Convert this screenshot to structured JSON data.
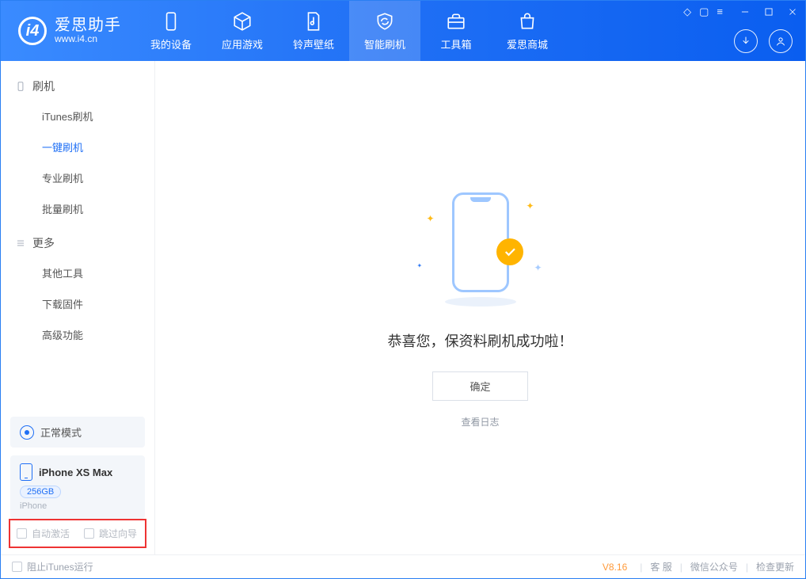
{
  "brand": {
    "title": "爱思助手",
    "sub": "www.i4.cn"
  },
  "tabs": [
    {
      "label": "我的设备"
    },
    {
      "label": "应用游戏"
    },
    {
      "label": "铃声壁纸"
    },
    {
      "label": "智能刷机"
    },
    {
      "label": "工具箱"
    },
    {
      "label": "爱思商城"
    }
  ],
  "sidebar": {
    "group1": {
      "title": "刷机"
    },
    "items1": [
      {
        "label": "iTunes刷机"
      },
      {
        "label": "一键刷机"
      },
      {
        "label": "专业刷机"
      },
      {
        "label": "批量刷机"
      }
    ],
    "group2": {
      "title": "更多"
    },
    "items2": [
      {
        "label": "其他工具"
      },
      {
        "label": "下载固件"
      },
      {
        "label": "高级功能"
      }
    ]
  },
  "mode": {
    "label": "正常模式"
  },
  "device": {
    "name": "iPhone XS Max",
    "storage": "256GB",
    "type": "iPhone"
  },
  "checks": {
    "auto_activate": "自动激活",
    "skip_guide": "跳过向导"
  },
  "main": {
    "success": "恭喜您，保资料刷机成功啦！",
    "ok": "确定",
    "view_log": "查看日志"
  },
  "footer": {
    "block_itunes": "阻止iTunes运行",
    "version": "V8.16",
    "service": "客 服",
    "wechat": "微信公众号",
    "update": "检查更新"
  }
}
